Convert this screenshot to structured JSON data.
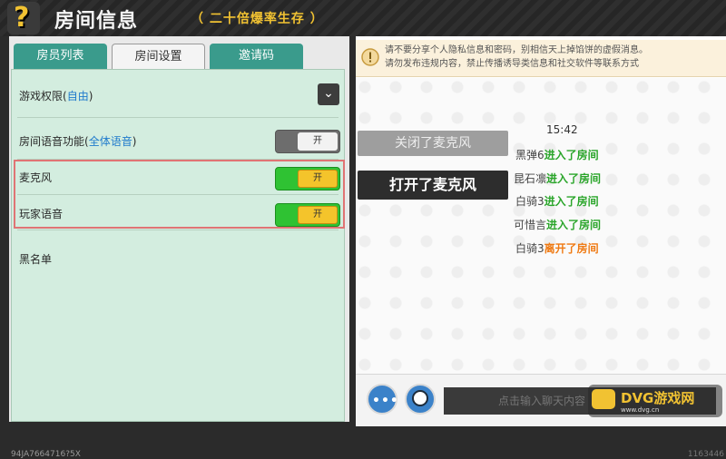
{
  "header": {
    "help_icon": "?",
    "title": "房间信息",
    "subtitle": "（ 二十倍爆率生存 ）"
  },
  "tabs": [
    {
      "label": "房员列表",
      "active": false
    },
    {
      "label": "房间设置",
      "active": true
    },
    {
      "label": "邀请码",
      "active": false
    }
  ],
  "settings": {
    "game_permission": {
      "label": "游戏权限",
      "value": "自由"
    },
    "room_voice": {
      "label": "房间语音功能",
      "value": "全体语音",
      "toggle_label": "开",
      "on": false
    },
    "microphone": {
      "label": "麦克风",
      "toggle_label": "开",
      "on": true
    },
    "player_voice": {
      "label": "玩家语音",
      "toggle_label": "开",
      "on": true
    },
    "blacklist": {
      "label": "黑名单"
    }
  },
  "footer_id": "94JA7664716?5X",
  "notice": {
    "line1": "请不要分享个人隐私信息和密码，别相信天上掉馅饼的虚假消息。",
    "line2": "请勿发布违规内容，禁止传播诱导类信息和社交软件等联系方式"
  },
  "chat": {
    "mic_off_button": "关闭了麦克风",
    "mic_on_button": "打开了麦克风",
    "time": "15:42",
    "messages": [
      {
        "name": "黑弹6",
        "action": "进入了房间",
        "type": "enter"
      },
      {
        "name": "昆石凛",
        "action": "进入了房间",
        "type": "enter"
      },
      {
        "name": "白骑3",
        "action": "进入了房间",
        "type": "enter"
      },
      {
        "name": "可惜言",
        "action": "进入了房间",
        "type": "enter"
      },
      {
        "name": "白骑3",
        "action": "离开了房间",
        "type": "leave"
      }
    ],
    "input_placeholder": "点击输入聊天内容",
    "footer_num": "1163446"
  },
  "watermark": {
    "text": "DVG游戏网",
    "url": "www.dvg.cn"
  },
  "colors": {
    "accent_green": "#2aa52a",
    "leave_orange": "#ef7a13",
    "tab_teal": "#3a9b8c",
    "toggle_yellow": "#f4c42b"
  }
}
